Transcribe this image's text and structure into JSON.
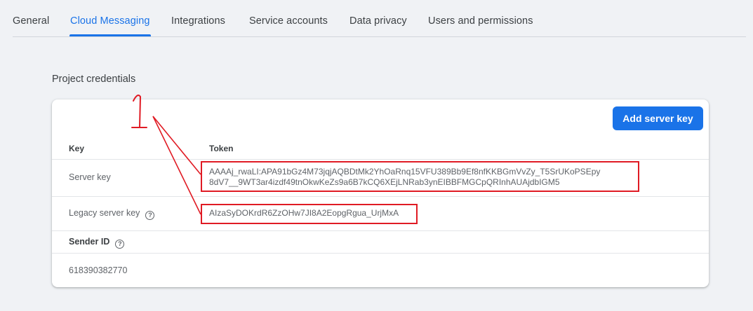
{
  "tabs": [
    {
      "label": "General",
      "active": false
    },
    {
      "label": "Cloud Messaging",
      "active": true
    },
    {
      "label": "Integrations",
      "active": false
    },
    {
      "label": "Service accounts",
      "active": false
    },
    {
      "label": "Data privacy",
      "active": false
    },
    {
      "label": "Users and permissions",
      "active": false
    }
  ],
  "section_title": "Project credentials",
  "card": {
    "add_button_label": "Add server key",
    "columns": {
      "key": "Key",
      "token": "Token"
    },
    "rows": [
      {
        "label": "Server key",
        "token_line1": "AAAAj_rwaLI:APA91bGz4M73jqjAQBDtMk2YhOaRnq15VFU389Bb9Ef8nfKKBGmVvZy_T5SrUKoPSEpy",
        "token_line2": "8dV7__9WT3ar4izdf49tnOkwKeZs9a6B7kCQ6XEjLNRab3ynEIBBFMGCpQRInhAUAjdbIGM5"
      },
      {
        "label": "Legacy server key",
        "token": "AIzaSyDOKrdR6ZzOHw7JI8A2EopgRgua_UrjMxA",
        "help_icon": "help-circle-icon"
      }
    ],
    "sender": {
      "label": "Sender ID",
      "value": "618390382770",
      "help_icon": "help-circle-icon"
    }
  },
  "annotation": {
    "marker_text": "1",
    "color": "#e01b24"
  },
  "colors": {
    "accent": "#1a73e8",
    "background": "#f0f2f5",
    "card": "#ffffff"
  }
}
